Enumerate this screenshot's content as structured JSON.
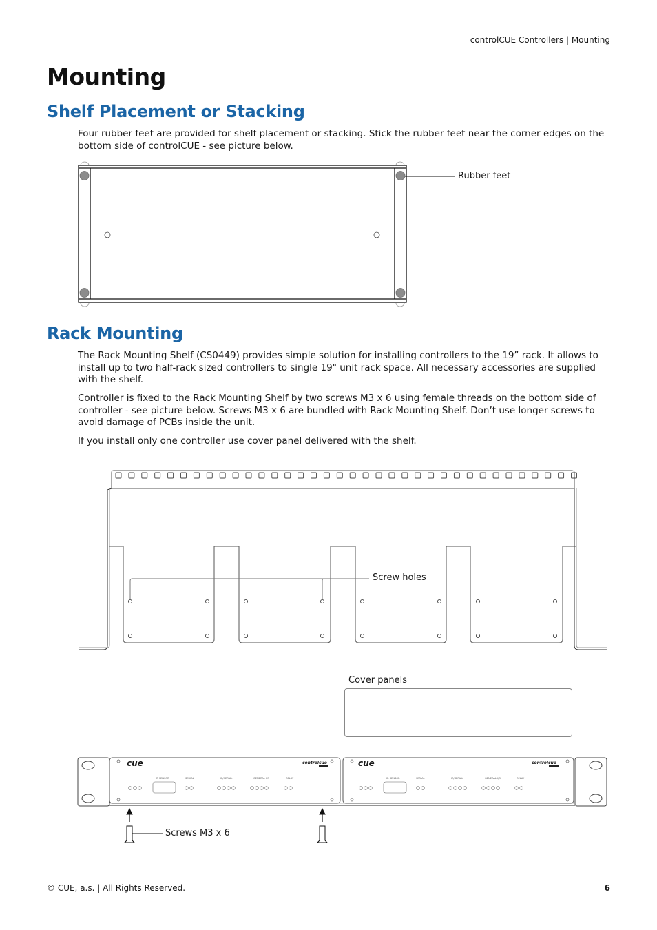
{
  "header": {
    "running_title": "controlCUE Controllers | Mounting"
  },
  "page": {
    "title": "Mounting"
  },
  "sections": [
    {
      "heading": "Shelf Placement or Stacking",
      "paragraphs": [
        "Four rubber feet are provided for shelf placement or stacking. Stick the rubber feet near the corner edges on the bottom side of controlCUE - see picture below."
      ],
      "figure": {
        "callouts": {
          "rubber_feet": "Rubber feet"
        }
      }
    },
    {
      "heading": "Rack Mounting",
      "paragraphs": [
        "The Rack Mounting Shelf (CS0449) provides simple solution for installing controllers to the 19” rack. It allows to install up to two half-rack sized controllers to single 19\" unit rack space. All necessary accessories are supplied with the shelf.",
        "Controller is fixed to the Rack Mounting Shelf by two screws M3 x 6 using female threads on the bottom side of controller - see picture below. Screws M3 x 6 are bundled with Rack Mounting Shelf. Don’t use longer screws to avoid damage of PCBs inside the unit.",
        "If you install only one controller use cover panel delivered with the shelf."
      ],
      "figure": {
        "callouts": {
          "screw_holes": "Screw holes",
          "cover_panels": "Cover panels",
          "screws": "Screws M3 x 6"
        },
        "device_front": {
          "brand_logo": "cue",
          "product_logo": "controlcue",
          "labels": [
            "IR SENSOR",
            "SERIAL",
            "IR/SERIAL",
            "GENERAL I/O",
            "RELAY"
          ],
          "sublabels": [
            "1 2",
            "1 2 3   4",
            "1 2 3   4 1",
            "1 2"
          ]
        }
      }
    }
  ],
  "footer": {
    "copyright": "© CUE, a.s. | All Rights Reserved.",
    "page_number": "6"
  }
}
